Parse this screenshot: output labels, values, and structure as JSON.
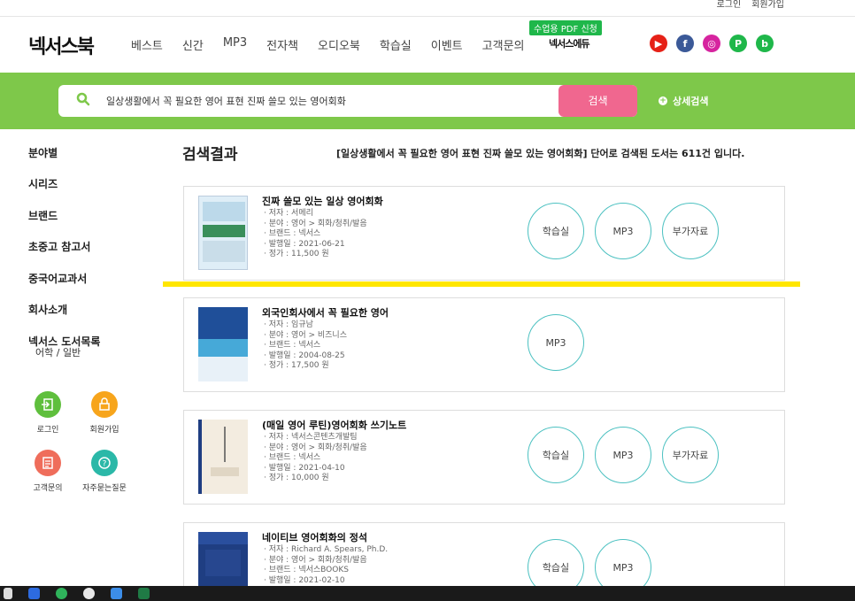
{
  "util": {
    "login": "로그인",
    "signup": "회원가입"
  },
  "header": {
    "logo": "넥서스북",
    "nav": [
      "베스트",
      "신간",
      "MP3",
      "전자책",
      "오디오북",
      "학습실",
      "이벤트",
      "고객문의"
    ],
    "pdf_badge": "수업용 PDF 신청",
    "edu_logo": "넥서스에듀",
    "social": [
      {
        "icon": "youtube-icon",
        "color": "#e62117",
        "glyph": "▶"
      },
      {
        "icon": "facebook-icon",
        "color": "#3b5998",
        "glyph": "f"
      },
      {
        "icon": "instagram-icon",
        "color": "#d6249f",
        "glyph": "◎"
      },
      {
        "icon": "post-icon",
        "color": "#1fb74a",
        "glyph": "P"
      },
      {
        "icon": "blog-icon",
        "color": "#1fb74a",
        "glyph": "b"
      }
    ]
  },
  "search": {
    "query": "일상생활에서 꼭 필요한 영어 표현 진짜 쓸모 있는 영어회화",
    "button": "검색",
    "advanced": "상세검색",
    "accent": "#7ec84a"
  },
  "sidebar": {
    "items": [
      "분야별",
      "시리즈",
      "브랜드",
      "초중고 참고서",
      "중국어교과서",
      "회사소개",
      "넥서스 도서목록"
    ],
    "catalog_sub": "어학  /  일반",
    "quick": [
      {
        "label": "로그인",
        "color": "#5fbf3d",
        "icon": "login-icon"
      },
      {
        "label": "회원가입",
        "color": "#f7a51c",
        "icon": "lock-icon"
      },
      {
        "label": "고객문의",
        "color": "#ef6d5b",
        "icon": "document-icon"
      },
      {
        "label": "자주묻는질문",
        "color": "#2bb8a8",
        "icon": "question-icon"
      }
    ]
  },
  "results": {
    "title": "검색결과",
    "summary": "[일상생활에서 꼭 필요한 영어 표현 진짜 쓸모 있는 영어회화] 단어로 검색된 도서는 611건 입니다.",
    "books": [
      {
        "title": "진짜 쓸모 있는 일상 영어회화",
        "author": "· 저자 : 서메리",
        "field": "· 분야 : 영어 > 회화/청취/발음",
        "brand": "· 브랜드 : 넥서스",
        "date": "· 발행일 : 2021-06-21",
        "price": "· 정가 : 11,500 원",
        "buttons": [
          "학습실",
          "MP3",
          "부가자료"
        ],
        "cover_color": "#dfeef7"
      },
      {
        "title": "외국인회사에서 꼭 필요한 영어",
        "author": "· 저자 : 임규남",
        "field": "· 분야 : 영어 > 비즈니스",
        "brand": "· 브랜드 : 넥서스",
        "date": "· 발행일 : 2004-08-25",
        "price": "· 정가 : 17,500 원",
        "buttons": [
          "MP3"
        ],
        "cover_color": "#2b5fa8"
      },
      {
        "title": "(매일 영어 루틴)영어회화 쓰기노트",
        "author": "· 저자 : 넥서스콘텐츠개발팀",
        "field": "· 분야 : 영어 > 회화/청취/발음",
        "brand": "· 브랜드 : 넥서스",
        "date": "· 발행일 : 2021-04-10",
        "price": "· 정가 : 10,000 원",
        "buttons": [
          "학습실",
          "MP3",
          "부가자료"
        ],
        "cover_color": "#f3ece0"
      },
      {
        "title": "네이티브 영어회화의 정석",
        "author": "· 저자 : Richard A. Spears, Ph.D.",
        "field": "· 분야 : 영어 > 회화/청취/발음",
        "brand": "· 브랜드 : 넥서스BOOKS",
        "date": "· 발행일 : 2021-02-10",
        "price": "",
        "buttons": [
          "학습실",
          "MP3"
        ],
        "cover_color": "#1f3e82"
      }
    ]
  }
}
